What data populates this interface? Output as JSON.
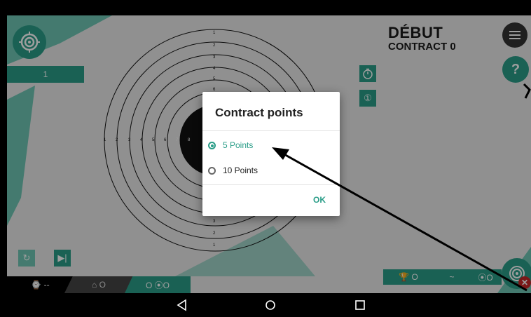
{
  "header": {
    "title": "DÉBUT",
    "subtitle": "CONTRACT 0"
  },
  "score_bar": {
    "label": "1"
  },
  "help_label": "?",
  "shot_counter": "①",
  "target": {
    "vertical_numbers_top": [
      "1",
      "2",
      "3",
      "4",
      "5",
      "6"
    ],
    "vertical_numbers_bottom": [
      "3",
      "2",
      "1"
    ],
    "horizontal_numbers": [
      "1",
      "2",
      "3",
      "4",
      "5",
      "6",
      "7",
      "8"
    ]
  },
  "dialog": {
    "title": "Contract points",
    "options": [
      {
        "label": "5 Points",
        "selected": true
      },
      {
        "label": "10 Points",
        "selected": false
      }
    ],
    "ok_label": "OK"
  },
  "bottom_bar": {
    "timer": "⌚ --",
    "tab2": "⌂ O",
    "tab3": "O ⦿O",
    "right_tab1": "🏆 O",
    "right_tab2": "~",
    "right_tab3": "⦿O"
  },
  "colors": {
    "accent": "#2a9d88",
    "accent_light": "#6fc6b4",
    "scrim": "rgba(0,0,0,0.38)"
  }
}
